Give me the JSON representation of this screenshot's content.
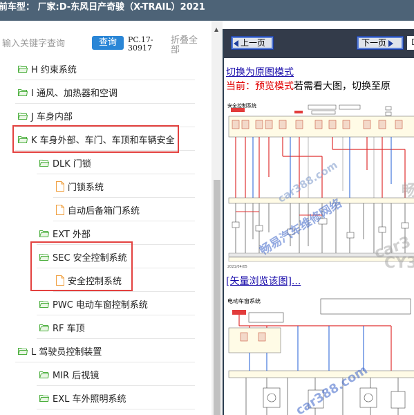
{
  "window": {
    "title": "前车型：  厂家:D-东风日产奇骏（X-TRAIL）2021"
  },
  "search": {
    "placeholder": "输入关键字查询",
    "button_label": "查询",
    "version": "PC.17-30917",
    "collapse_label": "折叠全部"
  },
  "tree": {
    "items": [
      {
        "label": "H 约束系统",
        "type": "folder",
        "level": 0
      },
      {
        "label": "I 通风、加热器和空调",
        "type": "folder",
        "level": 0
      },
      {
        "label": "J 车身内部",
        "type": "folder",
        "level": 0
      },
      {
        "label": "K 车身外部、车门、车顶和车辆安全",
        "type": "folder",
        "level": 0,
        "highlighted": true
      },
      {
        "label": "DLK 门锁",
        "type": "folder",
        "level": 1
      },
      {
        "label": "门锁系统",
        "type": "doc",
        "level": 2
      },
      {
        "label": "自动后备箱门系统",
        "type": "doc",
        "level": 2
      },
      {
        "label": "EXT 外部",
        "type": "folder",
        "level": 1
      },
      {
        "label": "SEC 安全控制系统",
        "type": "folder",
        "level": 1,
        "highlighted": true
      },
      {
        "label": "安全控制系统",
        "type": "doc",
        "level": 2,
        "highlighted": true
      },
      {
        "label": "PWC 电动车窗控制系统",
        "type": "folder",
        "level": 1
      },
      {
        "label": "RF 车顶",
        "type": "folder",
        "level": 1
      },
      {
        "label": "L 驾驶员控制装置",
        "type": "folder",
        "level": 0
      },
      {
        "label": "MIR 后视镜",
        "type": "folder",
        "level": 1
      },
      {
        "label": "EXL 车外照明系统",
        "type": "folder",
        "level": 1
      }
    ]
  },
  "viewer": {
    "prev_label": "上一页",
    "next_label": "下一页",
    "tail_text": "D",
    "switch_link": "切换为原图模式",
    "current_prefix": "当前：",
    "current_mode": "预览模式",
    "current_suffix": "若需看大图，切换至原",
    "vector_link": "[矢量浏览该图]...",
    "diagram1_title": "安全控制系统",
    "diagram2_title": "电动车窗系统",
    "watermarks": [
      "car388.com",
      "畅易汽车维修网络",
      "CY3",
      "畅",
      "car3"
    ]
  },
  "colors": {
    "titlebar": "#4d6377",
    "accent": "#2a86d6",
    "highlight": "#e3413f",
    "link": "#1a0dab",
    "red_text": "#e00000",
    "folder_green": "#4caf3e",
    "doc_orange": "#f0a040"
  }
}
